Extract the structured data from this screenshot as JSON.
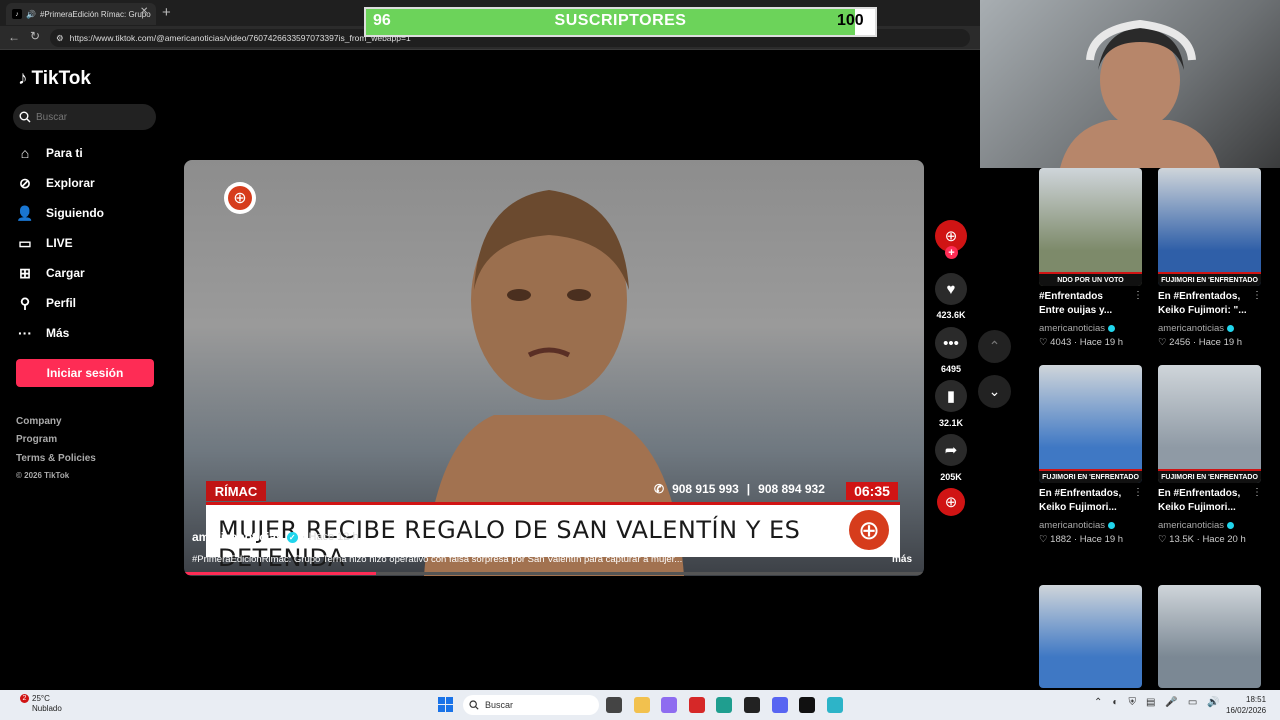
{
  "browser": {
    "tab_title": "#PrimeraEdición Rímac: Grupo",
    "url": "https://www.tiktok.com/@americanoticias/video/7607426633597073397is_from_webapp=1"
  },
  "subscribers": {
    "current": "96",
    "title": "SUSCRIPTORES",
    "goal": "100",
    "progress_fraction": 0.96
  },
  "sidebar": {
    "logo": "TikTok",
    "search_placeholder": "Buscar",
    "items": [
      {
        "label": "Para ti",
        "icon": "home-icon"
      },
      {
        "label": "Explorar",
        "icon": "compass-icon"
      },
      {
        "label": "Siguiendo",
        "icon": "following-icon"
      },
      {
        "label": "LIVE",
        "icon": "live-icon"
      },
      {
        "label": "Cargar",
        "icon": "upload-icon"
      },
      {
        "label": "Perfil",
        "icon": "profile-icon"
      },
      {
        "label": "Más",
        "icon": "more-icon"
      }
    ],
    "login_label": "Iniciar sesión",
    "footer_links": [
      "Company",
      "Program",
      "Terms & Policies"
    ],
    "copyright": "© 2026 TikTok"
  },
  "video": {
    "brand_tag": "RÍMAC",
    "phone_1": "908 915 993",
    "phone_sep": "|",
    "phone_2": "908 894 932",
    "clock": "06:35",
    "headline": "MUJER RECIBE REGALO DE SAN VALENTÍN Y ES DETENIDA",
    "author": "americanoticias",
    "posted": "· Hace 12 h",
    "caption": "#PrimeraEdiciónRimac: Grupo Terna hizo hizo operativo con falsa sorpresa por San Valentín para capturar a mujer...",
    "more_label": "más",
    "progress_fraction": 0.26
  },
  "actions": {
    "likes": "423.6K",
    "comments": "6495",
    "saves": "32.1K",
    "shares": "205K"
  },
  "grid": [
    {
      "strip": "NDO POR UN VOTO",
      "title_1": "#Enfrentados",
      "title_2": "Entre ouijas y...",
      "author": "americanoticias",
      "likes": "4043",
      "time": "Hace 19 h",
      "color": "#7d8a6a"
    },
    {
      "strip": "FUJIMORI EN 'ENFRENTADO",
      "title_1": "En #Enfrentados,",
      "title_2": "Keiko Fujimori: \"...",
      "author": "americanoticias",
      "likes": "2456",
      "time": "Hace 19 h",
      "color": "#2f5fa8"
    },
    {
      "strip": "FUJIMORI EN 'ENFRENTADO",
      "title_1": "En #Enfrentados,",
      "title_2": "Keiko Fujimori...",
      "author": "americanoticias",
      "likes": "1882",
      "time": "Hace 19 h",
      "color": "#3f78c4"
    },
    {
      "strip": "FUJIMORI EN 'ENFRENTADO",
      "title_1": "En #Enfrentados,",
      "title_2": "Keiko Fujimori...",
      "author": "americanoticias",
      "likes": "13.5K",
      "time": "Hace 20 h",
      "color": "#8f9aa5"
    },
    {
      "strip": "",
      "title_1": "",
      "title_2": "",
      "author": "",
      "likes": "",
      "time": "",
      "color": "#3f78c4"
    },
    {
      "strip": "",
      "title_1": "",
      "title_2": "",
      "author": "",
      "likes": "",
      "time": "",
      "color": "#7b8894"
    }
  ],
  "taskbar": {
    "temp": "25°C",
    "weather": "Nublado",
    "weather_badge": "2",
    "search_label": "Buscar",
    "time": "18:51",
    "date": "16/02/2026"
  }
}
